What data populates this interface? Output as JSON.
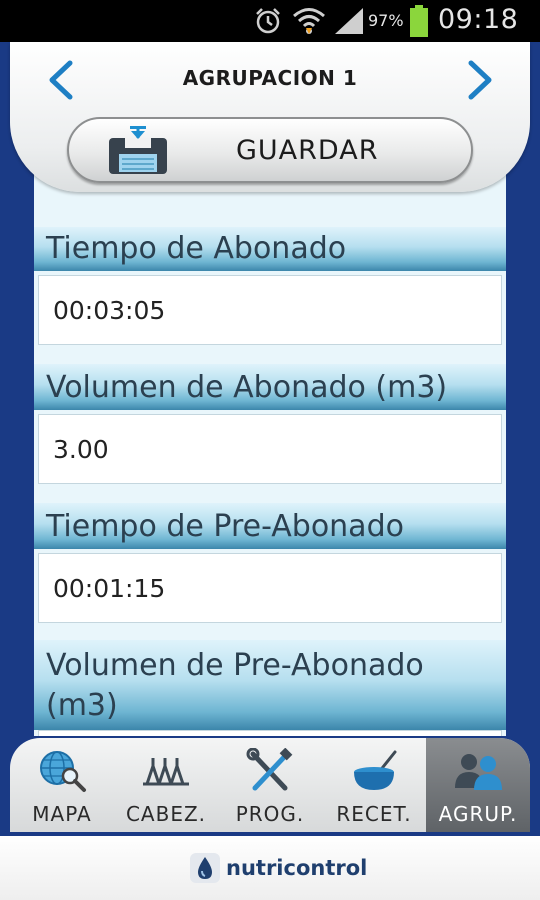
{
  "status_bar": {
    "battery_percent": "97%",
    "time": "09:18"
  },
  "header": {
    "title": "AGRUPACION 1",
    "save_label": "GUARDAR"
  },
  "sections": [
    {
      "label": "Tiempo de Abonado",
      "value": "00:03:05"
    },
    {
      "label": "Volumen de Abonado (m3)",
      "value": "3.00"
    },
    {
      "label": "Tiempo de Pre-Abonado",
      "value": "00:01:15"
    },
    {
      "label_line1": "Volumen de Pre-Abonado",
      "label_line2": "(m3)"
    }
  ],
  "tabs": [
    {
      "label": "MAPA",
      "icon": "globe-search-icon"
    },
    {
      "label": "CABEZ.",
      "icon": "valves-icon"
    },
    {
      "label": "PROG.",
      "icon": "tools-icon"
    },
    {
      "label": "RECET.",
      "icon": "bowl-icon"
    },
    {
      "label": "AGRUP.",
      "icon": "group-icon",
      "active": true
    }
  ],
  "footer": {
    "brand": "nutricontrol"
  },
  "colors": {
    "frame_blue": "#1a3a85",
    "accent_blue": "#1e7fc4",
    "header_gradient_dark": "#3c86ab"
  }
}
